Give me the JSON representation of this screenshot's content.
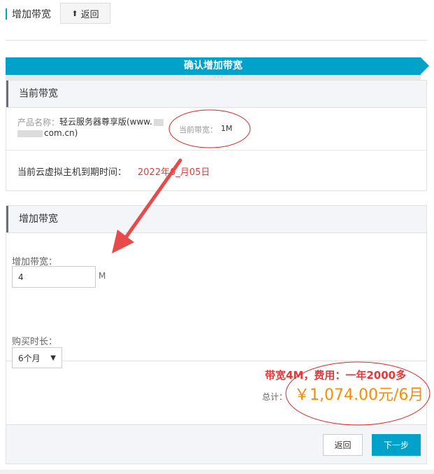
{
  "header": {
    "title": "增加带宽",
    "back_label": "返回"
  },
  "step": {
    "label": "确认增加带宽",
    "dots": "· · ·"
  },
  "current_panel": {
    "title": "当前带宽",
    "product_label": "产品名称：",
    "product_value_line1": "轻云服务器尊享版(www.",
    "product_value_line2": "com.cn)",
    "bandwidth_label": "当前带宽：",
    "bandwidth_value": "1M",
    "expiry_label": "当前云虚拟主机到期时间：",
    "expiry_value": "2022年0_月05日"
  },
  "add_panel": {
    "title": "增加带宽",
    "bandwidth_label": "增加带宽：",
    "bandwidth_input_value": "4",
    "bandwidth_unit": "M",
    "duration_label": "购买时长：",
    "duration_selected": "6个月",
    "annotation_note": "带宽4M，费用：一年2000多",
    "total_label": "总计：",
    "total_value": "￥1,074.00元/6月"
  },
  "footer": {
    "back_label": "返回",
    "next_label": "下一步"
  },
  "colors": {
    "accent": "#00a2ca",
    "price": "#ff8a00",
    "alert": "#e4393c",
    "annotation": "#e02424"
  },
  "icons": [
    "up-arrow-icon",
    "chevron-down-icon"
  ]
}
